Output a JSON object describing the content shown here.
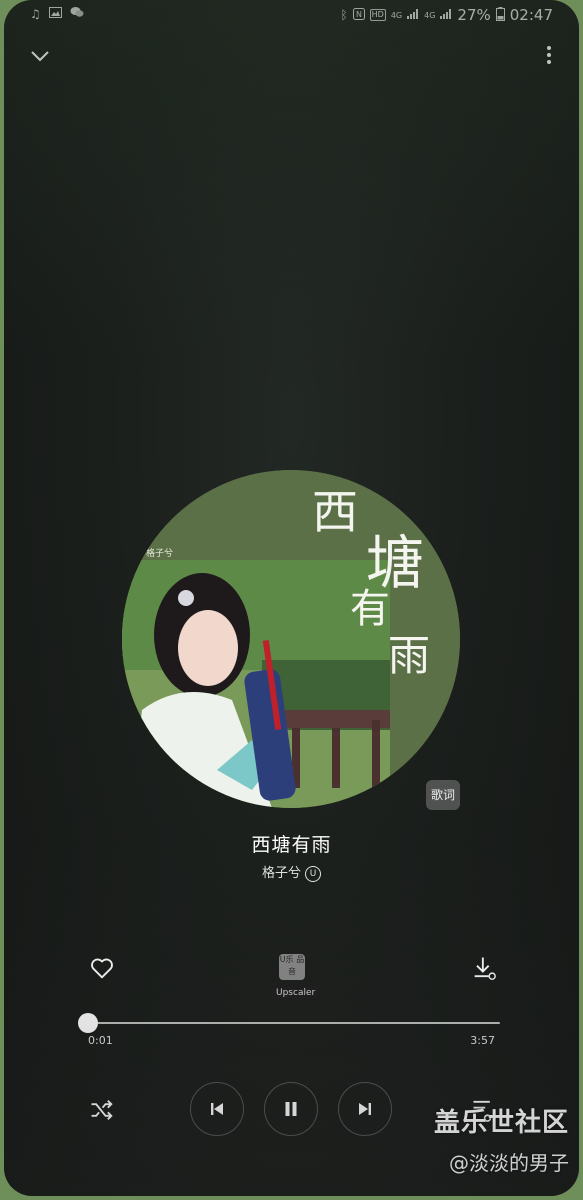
{
  "status_bar": {
    "left_icons": [
      "music-note-icon",
      "gallery-icon",
      "wechat-icon"
    ],
    "network_labels": [
      "HD",
      "4G",
      "4G"
    ],
    "battery": "27%",
    "time": "02:47"
  },
  "player": {
    "cover_text": {
      "title_chars": [
        "西",
        "塘",
        "有",
        "雨"
      ],
      "artist_small": "格子兮"
    },
    "lyrics_button": "歌词",
    "song_title": "西塘有雨",
    "artist": "格子兮",
    "artist_badge": "U",
    "upscaler": {
      "icon_text": "U乐 品音",
      "label": "Upscaler"
    },
    "progress": {
      "current": "0:01",
      "total": "3:57",
      "fraction": 0.004
    }
  },
  "watermark": {
    "main": "盖乐世社区",
    "sub": "@淡淡的男子"
  },
  "colors": {
    "background": "#1b1f1c",
    "cover_green": "#5c7048",
    "accent": "#ffffff"
  }
}
